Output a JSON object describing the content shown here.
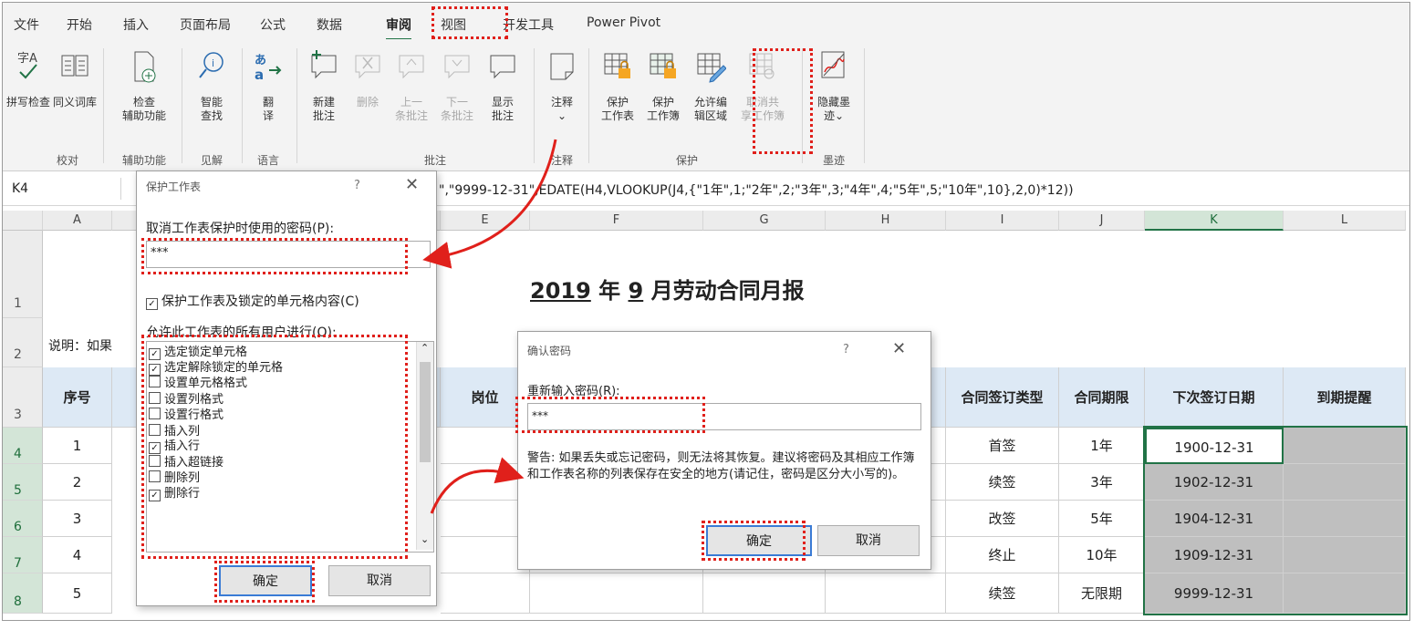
{
  "tabs": [
    "文件",
    "开始",
    "插入",
    "页面布局",
    "公式",
    "数据",
    "审阅",
    "视图",
    "开发工具",
    "Power Pivot"
  ],
  "active_tab": "审阅",
  "ribbon": {
    "spell": "拼写检查",
    "thesaurus": "同义词库",
    "check_access_1": "检查",
    "check_access_2": "辅助功能",
    "smart_lookup_1": "智能",
    "smart_lookup_2": "查找",
    "translate_1": "翻",
    "translate_2": "译",
    "new_comment_1": "新建",
    "new_comment_2": "批注",
    "delete": "删除",
    "prev_1": "上一",
    "prev_2": "条批注",
    "next_1": "下一",
    "next_2": "条批注",
    "show_1": "显示",
    "show_2": "批注",
    "notes": "注释",
    "protect_sheet_1": "保护",
    "protect_sheet_2": "工作表",
    "protect_wb_1": "保护",
    "protect_wb_2": "工作簿",
    "allow_edit_1": "允许编",
    "allow_edit_2": "辑区域",
    "unshare_1": "取消共",
    "unshare_2": "享工作簿",
    "hide_ink_1": "隐藏墨",
    "hide_ink_2": "迹",
    "groups": {
      "proofing": "校对",
      "accessibility": "辅助功能",
      "insights": "见解",
      "language": "语言",
      "comments": "批注",
      "notes": "注释",
      "protect": "保护",
      "ink": "墨迹"
    }
  },
  "formula_bar": {
    "name_box": "K4",
    "formula": "\",\"9999-12-31\",EDATE(H4,VLOOKUP(J4,{\"1年\",1;\"2年\",2;\"3年\",3;\"4年\",4;\"5年\",5;\"10年\",10},2,0)*12))"
  },
  "columns": [
    "A",
    "E",
    "F",
    "G",
    "H",
    "I",
    "J",
    "K",
    "L"
  ],
  "sheet": {
    "title_year": "2019",
    "title_mid": " 年 ",
    "title_month": "9",
    "title_end": " 月劳动合同月报",
    "note": "说明：如果",
    "headers": {
      "seq": "序号",
      "post": "岗位",
      "sign_type": "合同签订类型",
      "term": "合同期限",
      "next_date": "下次签订日期",
      "reminder": "到期提醒"
    },
    "rows": [
      {
        "row": "4",
        "seq": "1",
        "type": "首签",
        "term": "1年",
        "date": "1900-12-31"
      },
      {
        "row": "5",
        "seq": "2",
        "type": "续签",
        "term": "3年",
        "date": "1902-12-31"
      },
      {
        "row": "6",
        "seq": "3",
        "type": "改签",
        "term": "5年",
        "date": "1904-12-31"
      },
      {
        "row": "7",
        "seq": "4",
        "type": "终止",
        "term": "10年",
        "date": "1909-12-31"
      },
      {
        "row": "8",
        "seq": "5",
        "type": "续签",
        "term": "无限期",
        "date": "9999-12-31"
      }
    ],
    "row_numbers": [
      "1",
      "2",
      "3"
    ]
  },
  "protect_dialog": {
    "title": "保护工作表",
    "help": "?",
    "close": "✕",
    "password_label": "取消工作表保护时使用的密码(P):",
    "password_value": "***",
    "protect_check": "保护工作表及锁定的单元格内容(C)",
    "allow_label": "允许此工作表的所有用户进行(O):",
    "options": [
      {
        "label": "选定锁定单元格",
        "checked": "✓"
      },
      {
        "label": "选定解除锁定的单元格",
        "checked": "✓"
      },
      {
        "label": "设置单元格格式",
        "checked": ""
      },
      {
        "label": "设置列格式",
        "checked": ""
      },
      {
        "label": "设置行格式",
        "checked": ""
      },
      {
        "label": "插入列",
        "checked": ""
      },
      {
        "label": "插入行",
        "checked": "✓"
      },
      {
        "label": "插入超链接",
        "checked": ""
      },
      {
        "label": "删除列",
        "checked": ""
      },
      {
        "label": "删除行",
        "checked": "✓"
      }
    ],
    "ok": "确定",
    "cancel": "取消"
  },
  "confirm_dialog": {
    "title": "确认密码",
    "help": "?",
    "close": "✕",
    "reenter_label": "重新输入密码(R):",
    "password_value": "***",
    "warning": "警告: 如果丢失或忘记密码，则无法将其恢复。建议将密码及其相应工作簿和工作表名称的列表保存在安全的地方(请记住，密码是区分大小写的)。",
    "ok": "确定",
    "cancel": "取消"
  },
  "colors": {
    "accent": "#217346",
    "highlight": "#e0201b",
    "header_fill": "#dde9f5",
    "gray_fill": "#bfbfbf"
  }
}
